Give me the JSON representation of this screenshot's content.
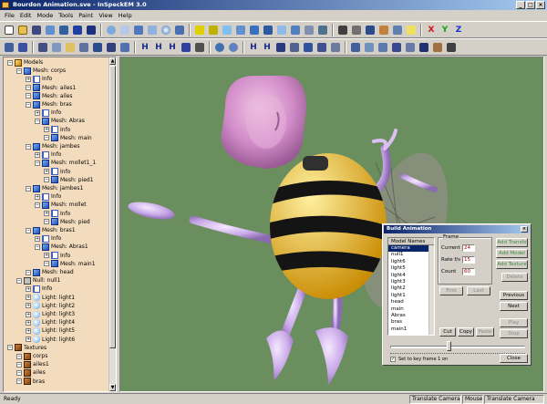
{
  "window": {
    "title": "Bourdon Animation.sve - InSpeckEM 3.0",
    "controls": [
      "_",
      "□",
      "×"
    ]
  },
  "menu": [
    "File",
    "Edit",
    "Mode",
    "Tools",
    "Paint",
    "View",
    "Help"
  ],
  "toolbar1": {
    "letters": {
      "x": "X",
      "y": "Y",
      "z": "Z"
    },
    "colors": {
      "x": "#d01010",
      "y": "#10a010",
      "z": "#1030d0"
    }
  },
  "toolbar2": {
    "letters": [
      "H",
      "H",
      "H",
      "H",
      "H"
    ]
  },
  "tree": {
    "items": [
      {
        "label": "Models",
        "depth": 0,
        "icon": "models"
      },
      {
        "label": "Mesh: corps",
        "depth": 1,
        "icon": "mesh"
      },
      {
        "label": "Info",
        "depth": 2,
        "icon": "info"
      },
      {
        "label": "Mesh: ailes1",
        "depth": 2,
        "icon": "mesh"
      },
      {
        "label": "Mesh: ailes",
        "depth": 2,
        "icon": "mesh"
      },
      {
        "label": "Mesh: bras",
        "depth": 2,
        "icon": "mesh"
      },
      {
        "label": "Info",
        "depth": 3,
        "icon": "info"
      },
      {
        "label": "Mesh: Abras",
        "depth": 3,
        "icon": "mesh"
      },
      {
        "label": "Info",
        "depth": 4,
        "icon": "info"
      },
      {
        "label": "Mesh: main",
        "depth": 4,
        "icon": "mesh"
      },
      {
        "label": "Mesh: jambes",
        "depth": 2,
        "icon": "mesh"
      },
      {
        "label": "Info",
        "depth": 3,
        "icon": "info"
      },
      {
        "label": "Mesh: mollet1_1",
        "depth": 3,
        "icon": "mesh"
      },
      {
        "label": "Info",
        "depth": 4,
        "icon": "info"
      },
      {
        "label": "Mesh: pied1",
        "depth": 4,
        "icon": "mesh"
      },
      {
        "label": "Mesh: jambes1",
        "depth": 2,
        "icon": "mesh"
      },
      {
        "label": "Info",
        "depth": 3,
        "icon": "info"
      },
      {
        "label": "Mesh: mollet",
        "depth": 3,
        "icon": "mesh"
      },
      {
        "label": "Info",
        "depth": 4,
        "icon": "info"
      },
      {
        "label": "Mesh: pied",
        "depth": 4,
        "icon": "mesh"
      },
      {
        "label": "Mesh: bras1",
        "depth": 2,
        "icon": "mesh"
      },
      {
        "label": "Info",
        "depth": 3,
        "icon": "info"
      },
      {
        "label": "Mesh: Abras1",
        "depth": 3,
        "icon": "mesh"
      },
      {
        "label": "Info",
        "depth": 4,
        "icon": "info"
      },
      {
        "label": "Mesh: main1",
        "depth": 4,
        "icon": "mesh"
      },
      {
        "label": "Mesh: head",
        "depth": 2,
        "icon": "mesh"
      },
      {
        "label": "Null: null1",
        "depth": 1,
        "icon": "null"
      },
      {
        "label": "Info",
        "depth": 2,
        "icon": "info"
      },
      {
        "label": "Light: light1",
        "depth": 2,
        "icon": "light"
      },
      {
        "label": "Light: light2",
        "depth": 2,
        "icon": "light"
      },
      {
        "label": "Light: light3",
        "depth": 2,
        "icon": "light"
      },
      {
        "label": "Light: light4",
        "depth": 2,
        "icon": "light"
      },
      {
        "label": "Light: light5",
        "depth": 2,
        "icon": "light"
      },
      {
        "label": "Light: light6",
        "depth": 2,
        "icon": "light"
      },
      {
        "label": "Textures",
        "depth": 0,
        "icon": "tex"
      },
      {
        "label": "corps",
        "depth": 1,
        "icon": "tex"
      },
      {
        "label": "ailes1",
        "depth": 1,
        "icon": "tex"
      },
      {
        "label": "ailes",
        "depth": 1,
        "icon": "tex"
      },
      {
        "label": "bras",
        "depth": 1,
        "icon": "tex"
      }
    ]
  },
  "dialog": {
    "title": "Build Animation",
    "close": "×",
    "list_header": "Model Names",
    "models": [
      "camera",
      "null1",
      "light6",
      "light5",
      "light4",
      "light3",
      "light2",
      "light1",
      "head",
      "main",
      "Abras",
      "bras",
      "main1"
    ],
    "selected_model": "camera",
    "frame_legend": "Frame",
    "current_label": "Current",
    "current_value": "24",
    "rate_label": "Rate f/s",
    "rate_value": "15",
    "count_label": "Count",
    "count_value": "60",
    "buttons": {
      "add_transfo": "Add Transfo",
      "add_model": "Add Model",
      "add_texture": "Add Texture",
      "delete": "Delete",
      "first": "First",
      "last": "Last",
      "previous": "Previous",
      "next": "Next",
      "cut": "Cut",
      "copy": "Copy",
      "paste": "Paste",
      "play": "Play",
      "stop": "Stop",
      "close": "Close"
    },
    "checkbox_label": "Set to key frame 1 on",
    "checkbox_checked": true,
    "slider_fraction": 0.43
  },
  "status": {
    "text": "Ready",
    "panels": [
      "Translate Camera",
      "Mouse",
      "Translate Camera"
    ]
  }
}
